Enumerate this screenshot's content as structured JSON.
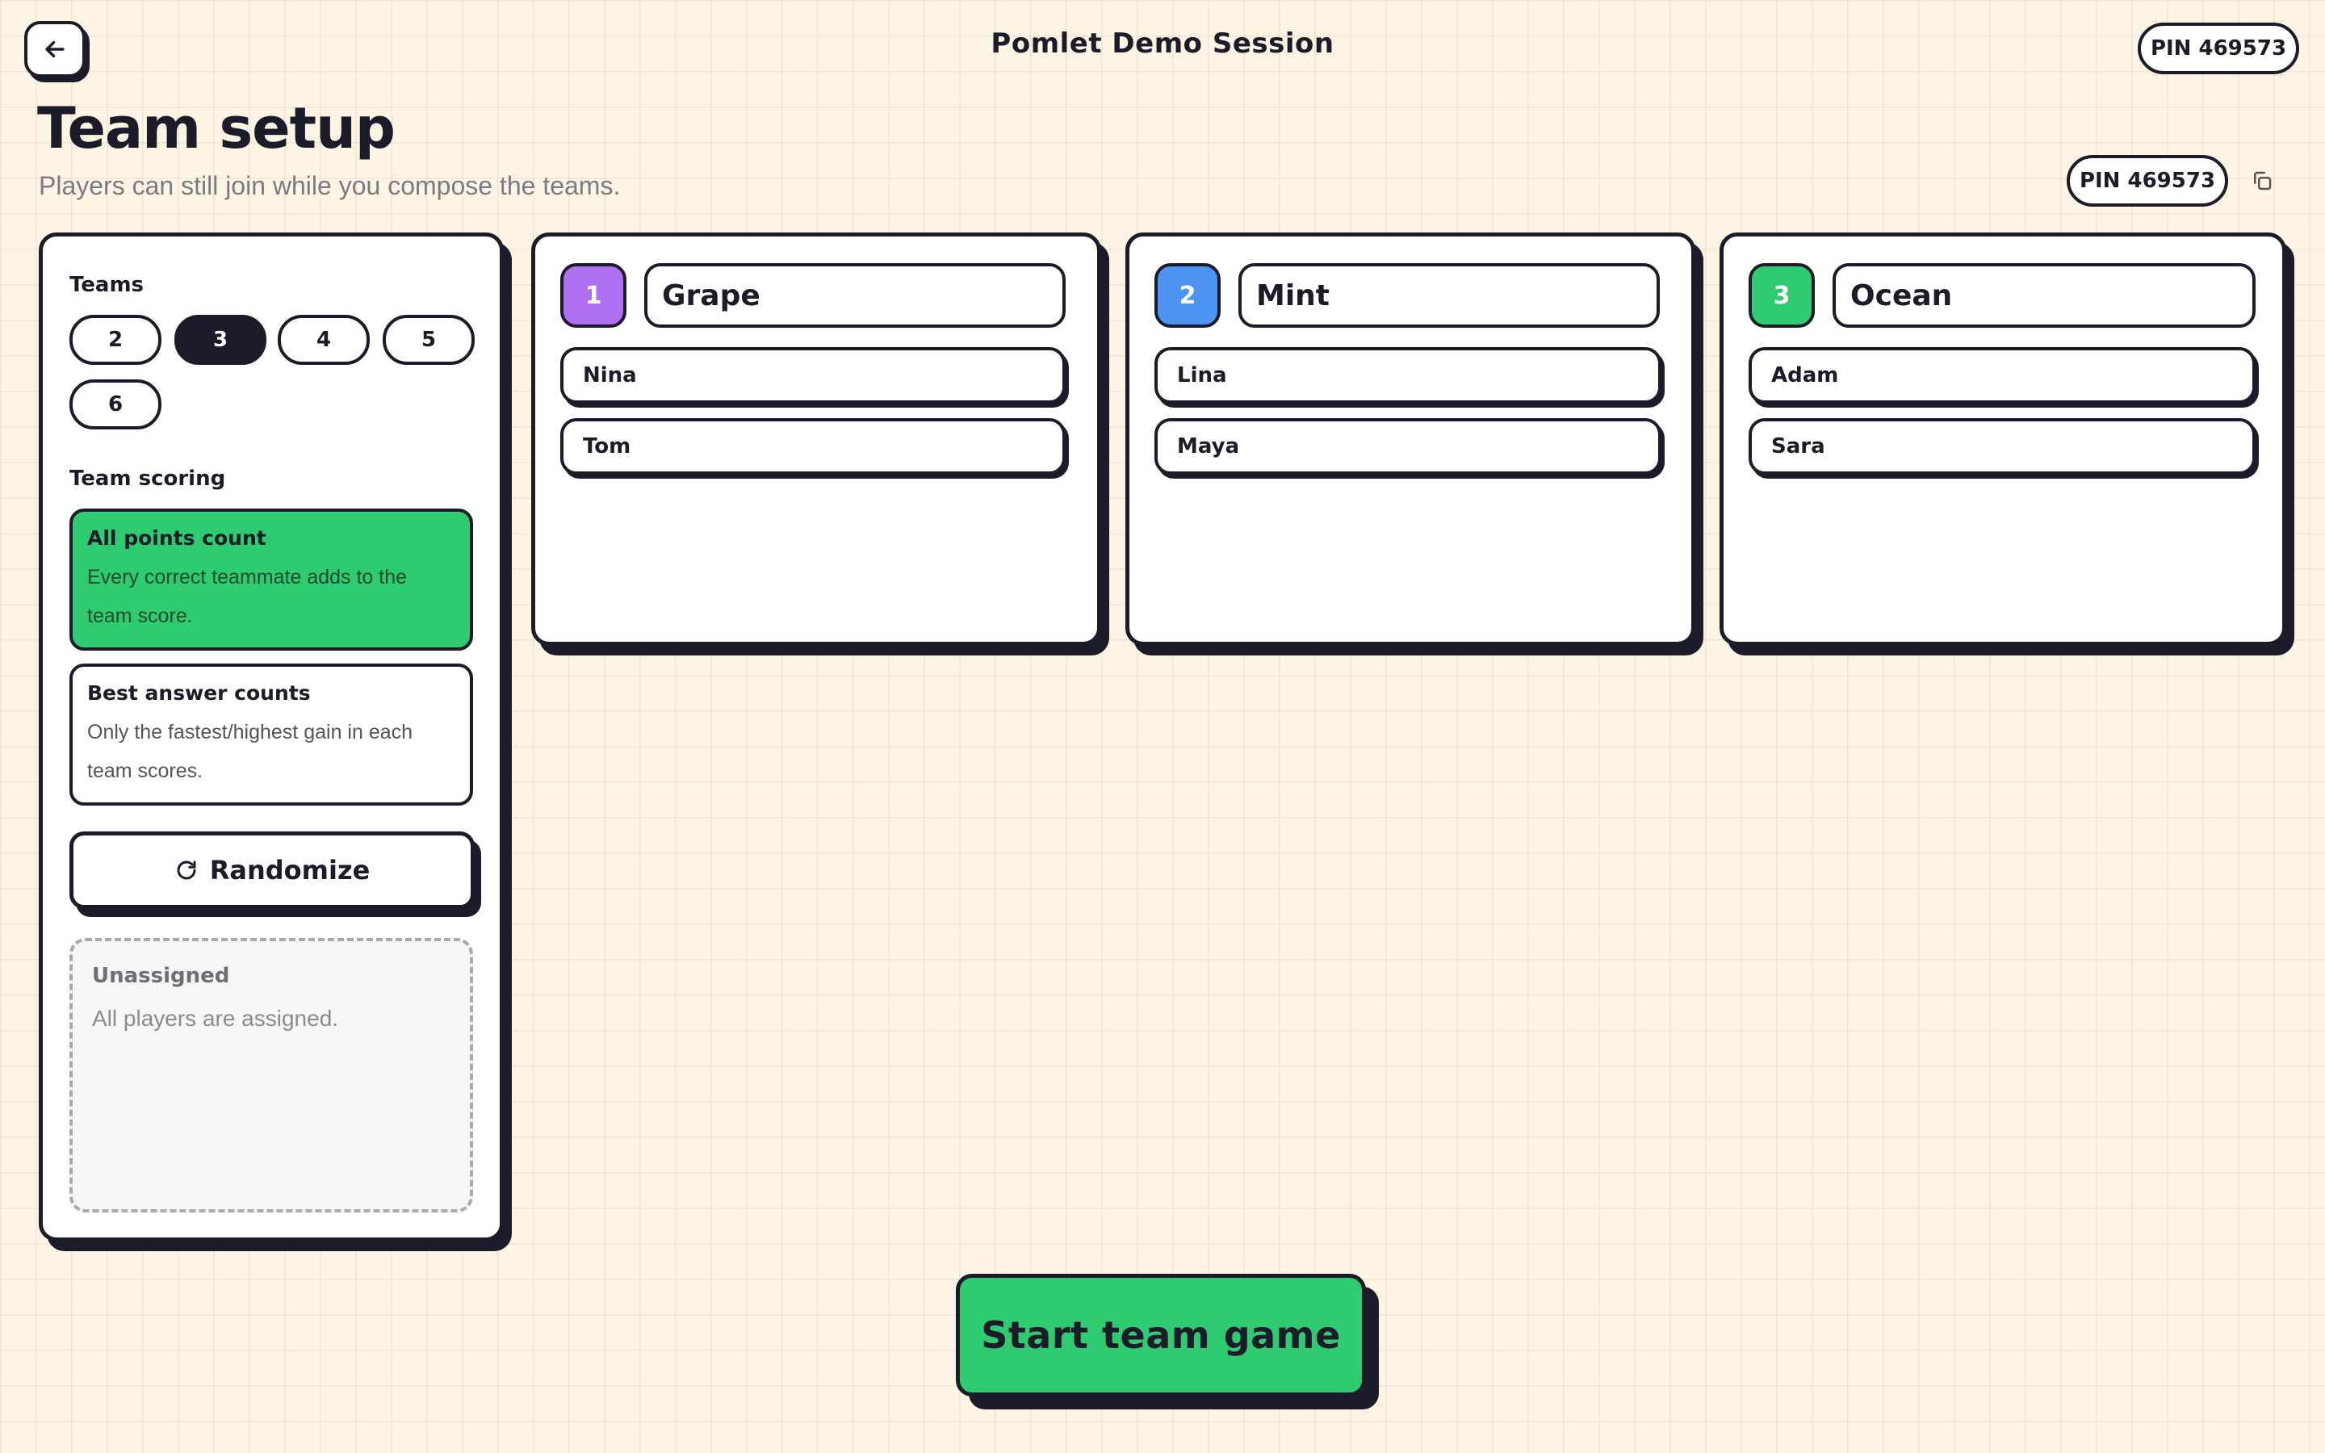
{
  "header": {
    "session_title": "Pomlet Demo Session",
    "pin_label": "PIN 469573"
  },
  "page": {
    "title": "Team setup",
    "subtitle": "Players can still join while you compose the teams.",
    "pin_label": "PIN 469573"
  },
  "sidebar": {
    "teams_label": "Teams",
    "team_counts": [
      "2",
      "3",
      "4",
      "5",
      "6"
    ],
    "selected_team_count": "3",
    "scoring_label": "Team scoring",
    "scoring_options": [
      {
        "title": "All points count",
        "description": "Every correct teammate adds to the team score.",
        "selected": true
      },
      {
        "title": "Best answer counts",
        "description": "Only the fastest/highest gain in each team scores.",
        "selected": false
      }
    ],
    "randomize_label": "Randomize",
    "unassigned_title": "Unassigned",
    "unassigned_empty": "All players are assigned."
  },
  "teams": [
    {
      "number": "1",
      "name": "Grape",
      "color": "#b06ef0",
      "players": [
        "Nina",
        "Tom"
      ]
    },
    {
      "number": "2",
      "name": "Mint",
      "color": "#4d94f5",
      "players": [
        "Lina",
        "Maya"
      ]
    },
    {
      "number": "3",
      "name": "Ocean",
      "color": "#2ecb70",
      "players": [
        "Adam",
        "Sara"
      ]
    }
  ],
  "footer": {
    "start_label": "Start team game"
  },
  "colors": {
    "background": "#fdf4e3",
    "ink": "#1b1b2a",
    "accent_green": "#2ecb70"
  }
}
